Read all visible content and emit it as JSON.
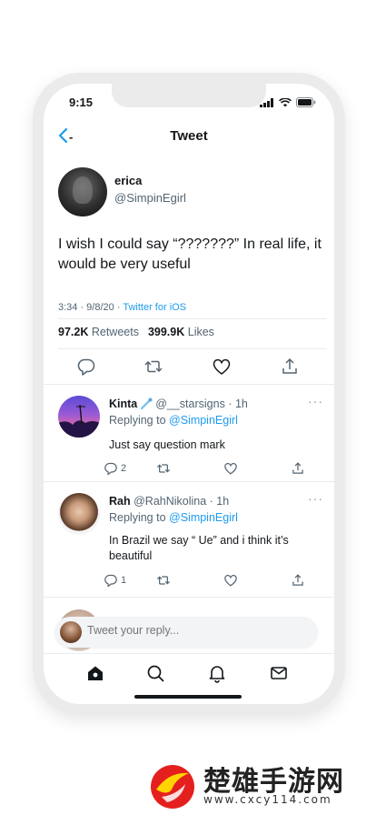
{
  "status_bar": {
    "time": "9:15"
  },
  "nav": {
    "back_label": "-",
    "title": "Tweet"
  },
  "tweet": {
    "author_name": "erica",
    "author_handle": "@SimpinEgirl",
    "text": "I wish I could say “???????” In real life, it would be very useful",
    "time": "3:34 · 9/8/20 · ",
    "client": "Twitter for iOS",
    "retweets_count": "97.2K",
    "retweets_label": "Retweets",
    "likes_count": "399.9K",
    "likes_label": "Likes"
  },
  "replies": [
    {
      "name": "Kinta",
      "handle": "@__starsigns",
      "sep_time": " · 1h",
      "replying_prefix": "Replying to ",
      "replying_mention": "@SimpinEgirl",
      "text": "Just say question mark",
      "reply_count": "2",
      "more": "···"
    },
    {
      "name": "Rah",
      "handle": "@RahNikolina",
      "sep_time": " · 1h",
      "replying_prefix": "Replying to ",
      "replying_mention": "@SimpinEgirl",
      "text": "In Brazil we say “ Ue” and i think it’s beautiful",
      "reply_count": "1",
      "more": "···"
    }
  ],
  "composer": {
    "placeholder": "Tweet your reply..."
  },
  "watermark": {
    "title": "楚雄手游网",
    "url": "www.cxcy114.com"
  },
  "colors": {
    "accent": "#1d9bf0",
    "text": "#14171a",
    "secondary": "#536471",
    "divider": "#e6ecf0"
  },
  "icons": [
    "back-chevron-icon",
    "reply-icon",
    "retweet-icon",
    "like-icon",
    "share-icon",
    "home-icon",
    "search-icon",
    "notifications-icon",
    "messages-icon",
    "more-icon"
  ]
}
